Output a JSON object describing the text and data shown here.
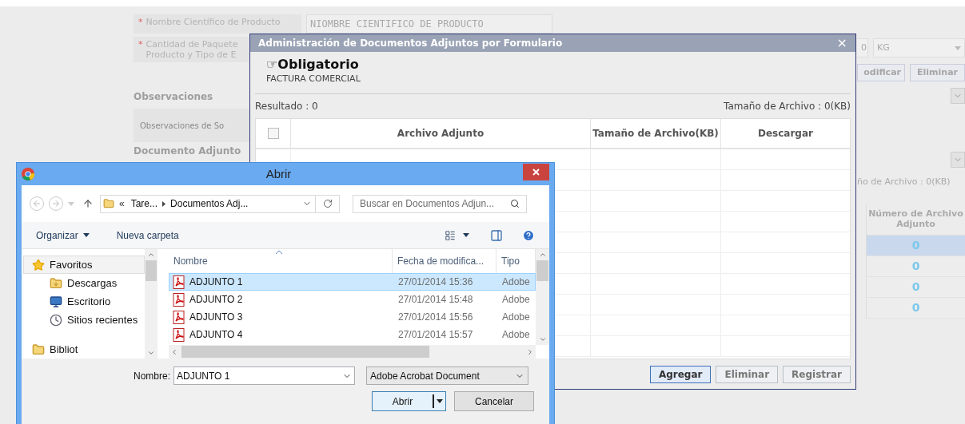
{
  "form": {
    "required_mark": "*",
    "rows": [
      {
        "required": true,
        "label_lines": [
          "Nombre Científico de Producto"
        ],
        "value": "NIOMBRE CIENTIFICO DE PRODUCTO"
      },
      {
        "required": true,
        "label_lines": [
          "Cantidad de Paquete",
          "Producto y Tipo de E"
        ]
      }
    ],
    "observations": {
      "heading": "Observaciones",
      "placeholder": "Observaciones de So"
    },
    "attachments_heading": "Documento Adjunto"
  },
  "side": {
    "quantity": "0",
    "unit": "KG",
    "buttons": [
      "odificar",
      "Eliminar"
    ],
    "file_size": "ño de Archivo : 0(KB)",
    "column_lines": [
      "Número de Archivo",
      "Adjunto"
    ],
    "rows": [
      {
        "value": "0",
        "selected": true
      },
      {
        "value": "0",
        "selected": false
      },
      {
        "value": "0",
        "selected": false
      },
      {
        "value": "0",
        "selected": false
      }
    ]
  },
  "modal": {
    "title": "Administración de Documentos Adjuntos por Formulario",
    "close": "×",
    "heading": "☞Obligatorio",
    "subheading": "FACTURA COMERCIAL",
    "result": "Resultado : 0",
    "file_size": "Tamaño de Archivo : 0(KB)",
    "select_all_checked": false,
    "columns": [
      "Archivo Adjunto",
      "Tamaño de Archivo(KB)",
      "Descargar"
    ],
    "buttons": [
      {
        "label": "Agregar",
        "primary": true
      },
      {
        "label": "Eliminar",
        "primary": false
      },
      {
        "label": "Registrar",
        "primary": false
      }
    ]
  },
  "file_dialog": {
    "title": "Abrir",
    "path_prefix": "«",
    "path": [
      "Tare...",
      "Documentos Adj..."
    ],
    "search_placeholder": "Buscar en Documentos Adjun...",
    "organize": "Organizar",
    "new_folder": "Nueva carpeta",
    "nav": [
      {
        "label": "Favoritos",
        "kind": "star",
        "selected": true,
        "children": [
          {
            "label": "Descargas",
            "kind": "download",
            "selected": false
          },
          {
            "label": "Escritorio",
            "kind": "desktop",
            "selected": false
          },
          {
            "label": "Sitios recientes",
            "kind": "recent",
            "selected": false
          }
        ]
      },
      {
        "label": "Bibliot",
        "kind": "folder",
        "selected": false
      }
    ],
    "columns": [
      "Nombre",
      "Fecha de modifica...",
      "Tipo"
    ],
    "files": [
      {
        "name": "ADJUNTO 1",
        "modified": "27/01/2014 15:36",
        "type": "Adobe",
        "selected": true
      },
      {
        "name": "ADJUNTO 2",
        "modified": "27/01/2014 15:48",
        "type": "Adobe",
        "selected": false
      },
      {
        "name": "ADJUNTO 3",
        "modified": "27/01/2014 15:56",
        "type": "Adobe",
        "selected": false
      },
      {
        "name": "ADJUNTO 4",
        "modified": "27/01/2014 15:57",
        "type": "Adobe",
        "selected": false
      }
    ],
    "filename_label": "Nombre:",
    "filename": "ADJUNTO 1",
    "filter": "Adobe Acrobat Document",
    "open": "Abrir",
    "cancel": "Cancelar"
  }
}
